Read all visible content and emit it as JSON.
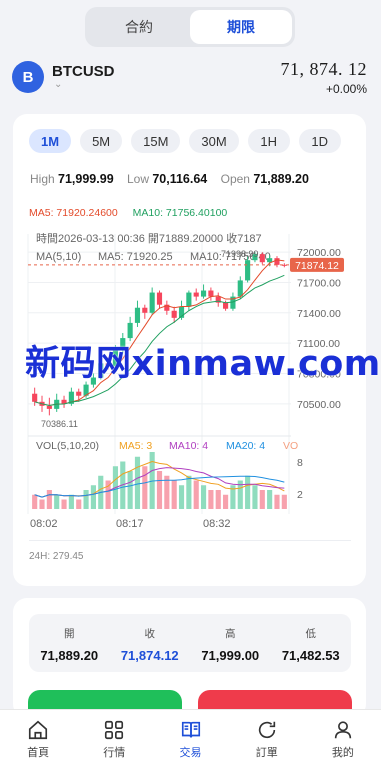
{
  "tabs": [
    "合約",
    "期限"
  ],
  "active_tab": 1,
  "symbol": {
    "icon_letter": "B",
    "name": "BTCUSD",
    "price": "71, 874. 12",
    "change": "+0.00%"
  },
  "intervals": [
    "1M",
    "5M",
    "15M",
    "30M",
    "1H",
    "1D"
  ],
  "active_interval": 0,
  "hlo": {
    "high_label": "High",
    "high": "71,999.99",
    "low_label": "Low",
    "low": "70,116.64",
    "open_label": "Open",
    "open": "71,889.20"
  },
  "ma_top": {
    "ma5": "MA5: 71920.24600",
    "ma10": "MA10: 71756.40100"
  },
  "chart_info": {
    "line1": "時間2026-03-13 00:36   開71889.20000   收7187",
    "line2_a": "MA(5,10)",
    "line2_b": "MA5: 71920.25",
    "line2_c": "MA10: 71756.40",
    "hi_marker": "71998.99",
    "low_marker": "70386.11",
    "vol_label": "VOL(5,10,20)",
    "vol_ma5": "MA5: 3",
    "vol_ma10": "MA10: 4",
    "vol_ma20": "MA20: 4",
    "vol_more": "VO",
    "last_price_tag": "71874.12",
    "y_labels": [
      "72000.00",
      "71700.00",
      "71400.00",
      "71100.00",
      "70800.00",
      "70500.00"
    ],
    "vol_y": [
      "8",
      "2"
    ],
    "x_labels": [
      "08:02",
      "08:17",
      "08:32"
    ]
  },
  "t24": "24H: 279.45",
  "stats": [
    {
      "label": "開",
      "value": "71,889.20"
    },
    {
      "label": "收",
      "value": "71,874.12"
    },
    {
      "label": "高",
      "value": "71,999.00"
    },
    {
      "label": "低",
      "value": "71,482.53"
    }
  ],
  "nav": [
    {
      "label": "首頁",
      "icon": "home-icon"
    },
    {
      "label": "行情",
      "icon": "grid-icon"
    },
    {
      "label": "交易",
      "icon": "book-icon"
    },
    {
      "label": "訂單",
      "icon": "refresh-icon"
    },
    {
      "label": "我的",
      "icon": "user-icon"
    }
  ],
  "active_nav": 2,
  "watermark": "新码网xinmaw.com",
  "colors": {
    "accent": "#1e4fd8",
    "up": "#2ebd85",
    "down": "#f6465d",
    "ma5": "#e34b2b",
    "ma10": "#20a060"
  },
  "chart_data": {
    "type": "candlestick",
    "ylim": [
      70350,
      72080
    ],
    "y_ticks": [
      72000,
      71700,
      71400,
      71100,
      70800,
      70500
    ],
    "last_price": 71874.12,
    "candles": [
      [
        70600,
        70520,
        70660,
        70480
      ],
      [
        70520,
        70480,
        70580,
        70420
      ],
      [
        70480,
        70450,
        70560,
        70386
      ],
      [
        70450,
        70540,
        70600,
        70420
      ],
      [
        70540,
        70500,
        70580,
        70460
      ],
      [
        70500,
        70620,
        70660,
        70480
      ],
      [
        70620,
        70580,
        70650,
        70520
      ],
      [
        70580,
        70690,
        70720,
        70560
      ],
      [
        70690,
        70760,
        70800,
        70660
      ],
      [
        70760,
        70900,
        70940,
        70740
      ],
      [
        70900,
        70870,
        70960,
        70840
      ],
      [
        70870,
        71050,
        71080,
        70850
      ],
      [
        71050,
        71150,
        71200,
        71000
      ],
      [
        71150,
        71300,
        71360,
        71120
      ],
      [
        71300,
        71450,
        71520,
        71260
      ],
      [
        71450,
        71400,
        71480,
        71340
      ],
      [
        71400,
        71600,
        71650,
        71380
      ],
      [
        71600,
        71480,
        71620,
        71440
      ],
      [
        71480,
        71420,
        71520,
        71380
      ],
      [
        71420,
        71350,
        71460,
        71300
      ],
      [
        71350,
        71460,
        71520,
        71330
      ],
      [
        71460,
        71600,
        71620,
        71420
      ],
      [
        71600,
        71560,
        71640,
        71520
      ],
      [
        71560,
        71620,
        71680,
        71540
      ],
      [
        71620,
        71560,
        71650,
        71520
      ],
      [
        71560,
        71500,
        71600,
        71460
      ],
      [
        71500,
        71440,
        71520,
        71420
      ],
      [
        71440,
        71560,
        71600,
        71420
      ],
      [
        71560,
        71720,
        71760,
        71540
      ],
      [
        71720,
        71920,
        71960,
        71700
      ],
      [
        71920,
        71980,
        71999,
        71900
      ],
      [
        71980,
        71900,
        71998,
        71880
      ],
      [
        71900,
        71940,
        71970,
        71860
      ],
      [
        71940,
        71874,
        71960,
        71850
      ],
      [
        71874,
        71870,
        71890,
        71850
      ]
    ],
    "volumes": [
      3,
      2,
      4,
      3,
      2,
      3,
      2,
      4,
      5,
      7,
      6,
      9,
      10,
      8,
      11,
      9,
      12,
      8,
      7,
      6,
      5,
      7,
      6,
      5,
      4,
      4,
      3,
      5,
      6,
      7,
      5,
      4,
      4,
      3,
      3
    ]
  }
}
